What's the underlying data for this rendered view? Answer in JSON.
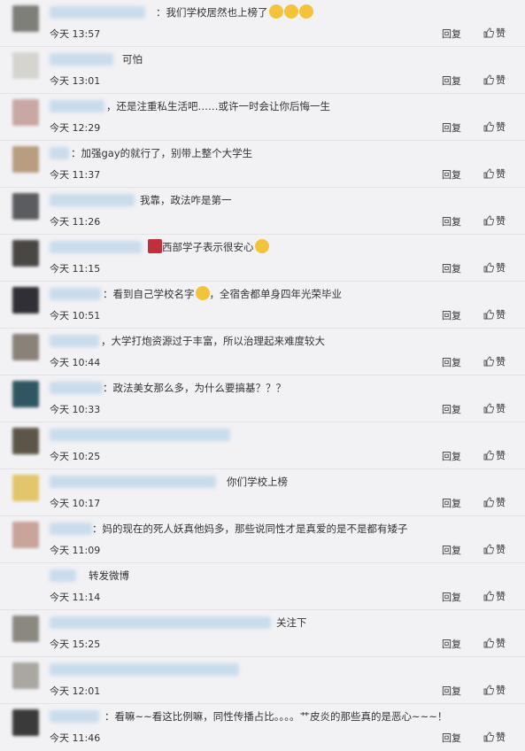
{
  "actions": {
    "reply": "回复",
    "like": "赞"
  },
  "comments": [
    {
      "text": "：我们学校居然也上榜了",
      "time": "今天 13:57",
      "emoji": [
        "#f3c43b",
        "#f3c43b",
        "#f3c43b"
      ],
      "emoji_icon": "crying-face-icon",
      "avatar": "#7f7f79"
    },
    {
      "text": "可怕",
      "time": "今天 13:01",
      "avatar": "#d6d4cf"
    },
    {
      "text": "，还是注重私生活吧……或许一时会让你后悔一生",
      "time": "今天 12:29",
      "avatar": "#c9a7a2"
    },
    {
      "text": "：加强gay的就行了，别带上整个大学生",
      "time": "今天 11:37",
      "avatar": "#b89d80"
    },
    {
      "text": "我靠，政法咋是第一",
      "time": "今天 11:26",
      "avatar": "#5b5c60"
    },
    {
      "text": "西部学子表示很安心",
      "time": "今天 11:15",
      "emoji_pre": "#c0303a",
      "emoji_pre_icon": "badge-icon",
      "emoji_post": "#f3c43b",
      "emoji_post_icon": "cat-face-icon",
      "avatar": "#4a4644"
    },
    {
      "text": "：看到自己学校名字",
      "text2": "，全宿舍都单身四年光荣毕业",
      "time": "今天 10:51",
      "emoji_mid": "#f3c43b",
      "emoji_mid_icon": "laughing-crying-icon",
      "avatar": "#2f2f35"
    },
    {
      "text": "，大学打炮资源过于丰富，所以治理起来难度较大",
      "time": "今天 10:44",
      "avatar": "#8a8179"
    },
    {
      "text": "：政法美女那么多，为什么要搞基？？？",
      "time": "今天 10:33",
      "avatar": "#2f5662"
    },
    {
      "text": "",
      "time": "今天 10:25",
      "avatar": "#5d5648"
    },
    {
      "text": "你们学校上榜",
      "time": "今天 10:17",
      "avatar": "#e2c66b"
    },
    {
      "text": "：妈的现在的死人妖真他妈多，那些说同性才是真爱的是不是都有矮子",
      "time": "今天 11:09",
      "avatar": "#c8a49a"
    },
    {
      "text": "转发微博",
      "time": "今天 11:14",
      "avatar": "#f2f2f5"
    },
    {
      "text": "关注下",
      "time": "今天 15:25",
      "avatar": "#8b8880"
    },
    {
      "text": "",
      "time": "今天 12:01",
      "avatar": "#aaa7a1"
    },
    {
      "text": "：看嘛~~看这比例嘛，同性传播占比。。。。艹皮炎的那些真的是恶心~~~！",
      "time": "今天 11:46",
      "avatar": "#3a3a3a"
    }
  ]
}
